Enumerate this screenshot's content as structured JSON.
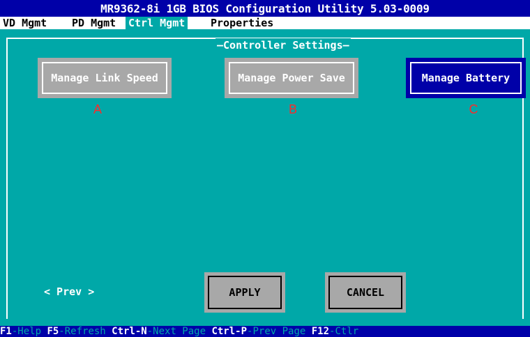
{
  "title": "MR9362-8i 1GB BIOS Configuration Utility 5.03-0009",
  "tabs": [
    {
      "label": "VD Mgmt"
    },
    {
      "label": "PD Mgmt"
    },
    {
      "label": "Ctrl Mgmt"
    },
    {
      "label": "Properties"
    }
  ],
  "active_tab": "Ctrl Mgmt",
  "frame_title": "Controller Settings",
  "buttons": {
    "link_speed": "Manage Link Speed",
    "power_save": "Manage Power Save",
    "battery": "Manage Battery"
  },
  "markers": [
    "A",
    "B",
    "C"
  ],
  "prev_label": "< Prev >",
  "apply_label": "APPLY",
  "cancel_label": "CANCEL",
  "status_bar": [
    {
      "key": "F1",
      "desc": "-Help "
    },
    {
      "key": "F5",
      "desc": "-Refresh "
    },
    {
      "key": "Ctrl-N",
      "desc": "-Next Page "
    },
    {
      "key": "Ctrl-P",
      "desc": "-Prev Page "
    },
    {
      "key": "F12",
      "desc": "-Ctlr"
    }
  ],
  "colors": {
    "bios_blue": "#0000a8",
    "bios_cyan": "#00a8a8",
    "button_grey": "#a8a8a8",
    "marker_red": "#ff2a2a"
  }
}
